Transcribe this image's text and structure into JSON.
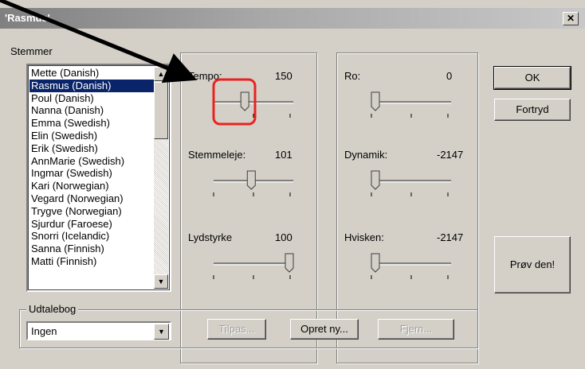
{
  "window": {
    "title": "'Rasmus'",
    "close_label": "✕"
  },
  "voices": {
    "label": "Stemmer",
    "items": [
      "Mette (Danish)",
      "Rasmus (Danish)",
      "Poul (Danish)",
      "Nanna (Danish)",
      "Emma (Swedish)",
      "Elin (Swedish)",
      "Erik (Swedish)",
      "AnnMarie (Swedish)",
      "Ingmar (Swedish)",
      "Kari (Norwegian)",
      "Vegard (Norwegian)",
      "Trygve (Norwegian)",
      "Sjurdur (Faroese)",
      "Snorri (Icelandic)",
      "Sanna (Finnish)",
      "Matti (Finnish)"
    ],
    "selected_index": 1
  },
  "sliders": [
    {
      "label": "Tempo:",
      "value": "150",
      "level": 0.38
    },
    {
      "label": "Stemmeleje:",
      "value": "101",
      "level": 0.47
    },
    {
      "label": "Lydstyrke",
      "value": "100",
      "level": 1.0
    },
    {
      "label": "Ro:",
      "value": "0",
      "level": 0.0
    },
    {
      "label": "Dynamik:",
      "value": "-2147",
      "level": 0.0
    },
    {
      "label": "Hvisken:",
      "value": "-2147",
      "level": 0.0
    }
  ],
  "buttons": {
    "ok": "OK",
    "cancel": "Fortryd",
    "try": "Prøv den!"
  },
  "dictionary": {
    "label": "Udtalebog",
    "selected": "Ingen",
    "adjust": "Tilpas...",
    "create": "Opret ny...",
    "remove": "Fjern..."
  },
  "colors": {
    "selection": "#0a246a",
    "highlight_box": "#e8231f",
    "arrow": "#000000"
  }
}
